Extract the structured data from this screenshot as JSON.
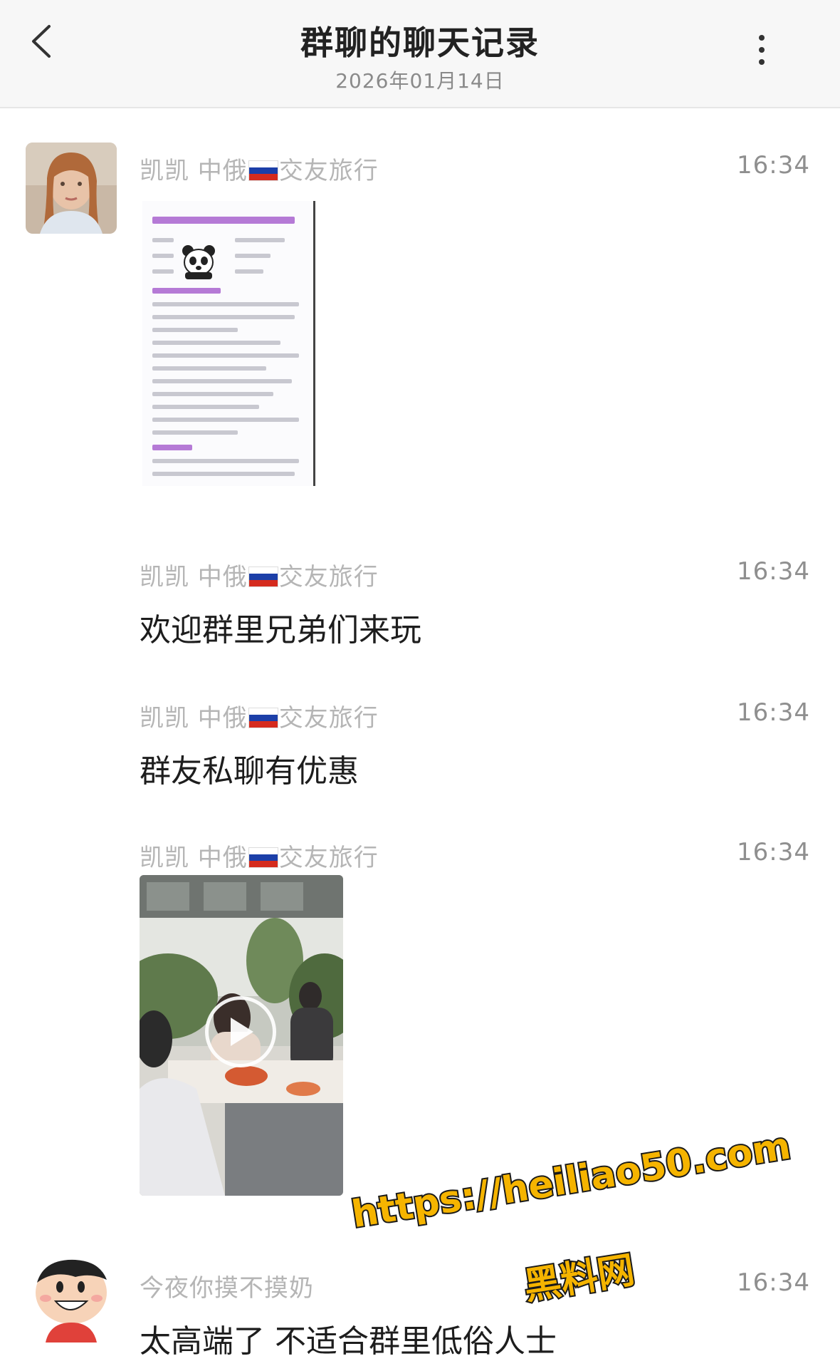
{
  "header": {
    "title": "群聊的聊天记录",
    "date": "2026年01月14日"
  },
  "messages": [
    {
      "sender_prefix": "凯凯 中俄",
      "sender_suffix": "交友旅行",
      "time": "16:34",
      "type": "image"
    },
    {
      "sender_prefix": "凯凯 中俄",
      "sender_suffix": "交友旅行",
      "time": "16:34",
      "type": "text",
      "text": "欢迎群里兄弟们来玩"
    },
    {
      "sender_prefix": "凯凯 中俄",
      "sender_suffix": "交友旅行",
      "time": "16:34",
      "type": "text",
      "text": "群友私聊有优惠"
    },
    {
      "sender_prefix": "凯凯 中俄",
      "sender_suffix": "交友旅行",
      "time": "16:34",
      "type": "video"
    },
    {
      "sender": "今夜你摸不摸奶",
      "time": "16:34",
      "type": "text",
      "text": "太高端了 不适合群里低俗人士"
    }
  ],
  "watermark": {
    "url": "https://heiliao50.com",
    "name": "黑料网"
  },
  "colors": {
    "header_bg": "#f7f7f7",
    "sender_text": "#b5b5b5",
    "time_text": "#8f8f8f",
    "watermark": "#f5b400"
  }
}
